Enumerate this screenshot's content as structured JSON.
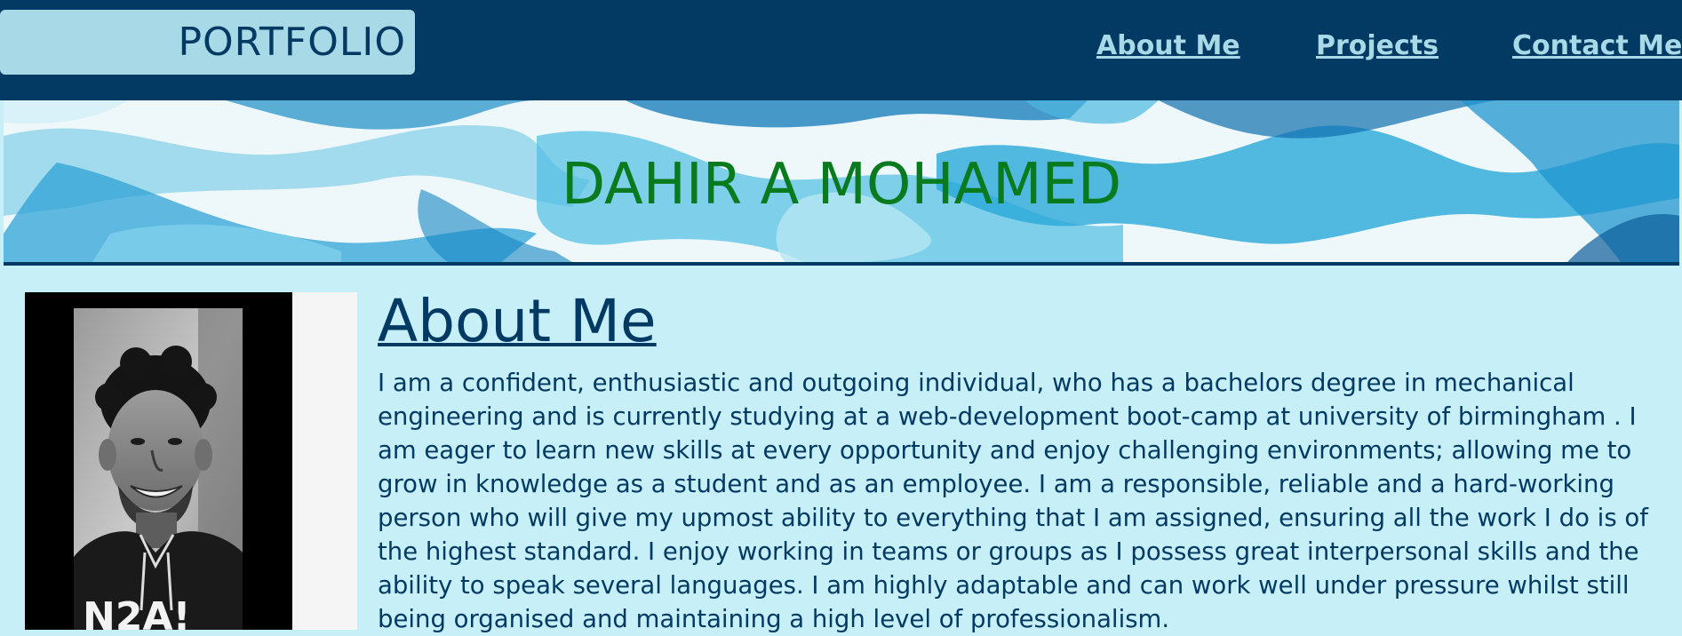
{
  "header": {
    "logo_text": "PORTFOLIO",
    "nav": [
      {
        "label": "About Me"
      },
      {
        "label": "Projects"
      },
      {
        "label": "Contact Me"
      }
    ]
  },
  "hero": {
    "title": "DAHIR A MOHAMED"
  },
  "about": {
    "heading": "About Me",
    "body": "I am a confident, enthusiastic and outgoing individual, who has a bachelors degree in mechanical engineering and is currently studying at a web-development boot-camp at university of birmingham . I am eager to learn new skills at every opportunity and enjoy challenging environments; allowing me to grow in knowledge as a student and as an employee. I am a responsible, reliable and a hard-working person who will give my upmost ability to everything that I am assigned, ensuring all the work I do is of the highest standard. I enjoy working in teams or groups as I possess great interpersonal skills and the ability to speak several languages. I am highly adaptable and can work well under pressure whilst still being organised and maintaining a high level of professionalism."
  },
  "colors": {
    "nav_bg": "#023a63",
    "page_bg": "#c7eff7",
    "logo_bg": "#a8d9e6",
    "hero_title": "#0a7a1e"
  }
}
